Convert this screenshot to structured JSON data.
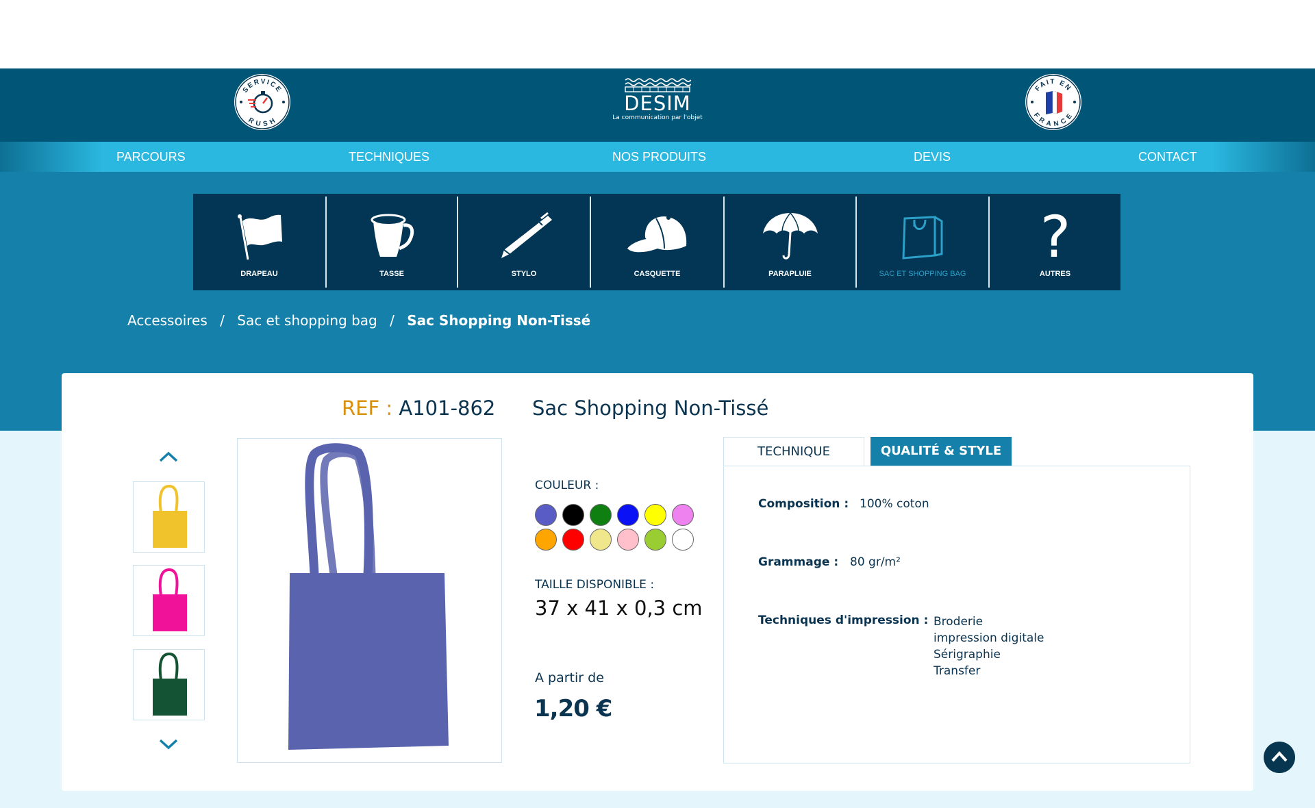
{
  "header": {
    "logo": {
      "name": "DESIM",
      "tagline": "La communication par l'objet"
    },
    "badge_left": {
      "text_top": "SERVICE",
      "text_bottom": "RUSH",
      "icon": "stopwatch-icon"
    },
    "badge_right": {
      "text_top": "FAIT EN",
      "text_bottom": "FRANCE",
      "icon": "france-flag-icon"
    }
  },
  "nav": {
    "items": [
      {
        "label": "PARCOURS"
      },
      {
        "label": "TECHNIQUES"
      },
      {
        "label": "NOS PRODUITS"
      },
      {
        "label": "DEVIS"
      },
      {
        "label": "CONTACT"
      }
    ]
  },
  "categories": [
    {
      "label": "DRAPEAU",
      "icon": "flag-icon",
      "active": false
    },
    {
      "label": "TASSE",
      "icon": "mug-icon",
      "active": false
    },
    {
      "label": "STYLO",
      "icon": "pen-icon",
      "active": false
    },
    {
      "label": "CASQUETTE",
      "icon": "cap-icon",
      "active": false
    },
    {
      "label": "PARAPLUIE",
      "icon": "umbrella-icon",
      "active": false
    },
    {
      "label": "SAC ET SHOPPING BAG",
      "icon": "shopping-bag-icon",
      "active": true
    },
    {
      "label": "AUTRES",
      "icon": "question-mark-icon",
      "active": false
    }
  ],
  "breadcrumb": {
    "items": [
      "Accessoires",
      "Sac et shopping bag",
      "Sac Shopping Non-Tissé"
    ],
    "separator": "/"
  },
  "product": {
    "ref_label": "REF :",
    "ref_value": "A101-862",
    "title": "Sac Shopping Non-Tissé",
    "color_label": "COULEUR :",
    "colors": [
      "#5a5cc6",
      "#000000",
      "#0f7f11",
      "#0b11f5",
      "#ffff00",
      "#ee82ee",
      "#ffa500",
      "#ff0000",
      "#f0e68c",
      "#ffc0cb",
      "#9acd32",
      "#ffffff"
    ],
    "size_label": "TAILLE DISPONIBLE :",
    "size_value": "37 x 41 x 0,3 cm",
    "price_from": "A partir de",
    "price": "1,20 €",
    "main_image_color": "#5a63ad",
    "thumbnails": [
      {
        "color": "#f0c32c"
      },
      {
        "color": "#f0139a"
      },
      {
        "color": "#145434"
      }
    ]
  },
  "tabs": {
    "technique": "TECHNIQUE",
    "qualite": "QUALITÉ & STYLE",
    "active": "qualite"
  },
  "specs": {
    "composition_label": "Composition :",
    "composition_value": "100% coton",
    "grammage_label": "Grammage :",
    "grammage_value": "80 gr/m²",
    "techniques_label": "Techniques d'impression :",
    "techniques": [
      "Broderie",
      "impression digitale",
      "Sérigraphie",
      "Transfer"
    ]
  },
  "colors": {
    "header_bg": "#015677",
    "nav_bg": "#2ab8e0",
    "band_bg": "#1581ab",
    "catbar_bg": "#033654",
    "accent_orange": "#d9900f",
    "text_dark": "#0b3450"
  }
}
